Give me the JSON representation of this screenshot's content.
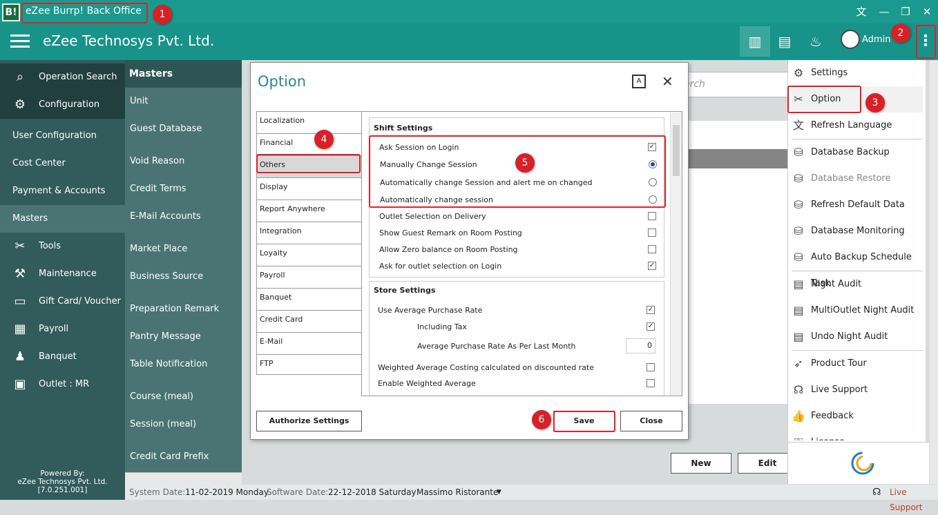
{
  "app": {
    "logo": "B!",
    "title": "eZee Burrp! Back Office",
    "company": "eZee Technosys Pvt. Ltd.",
    "admin": "Admin"
  },
  "nav": {
    "items": [
      {
        "label": "Operation Search",
        "icon": "search-icon"
      },
      {
        "label": "Configuration",
        "icon": "gear-icon"
      },
      {
        "label": "Tools",
        "icon": "tools-icon"
      },
      {
        "label": "Maintenance",
        "icon": "maintenance-icon"
      },
      {
        "label": "Gift Card/ Voucher",
        "icon": "gift-card-icon"
      },
      {
        "label": "Payroll",
        "icon": "payroll-icon"
      },
      {
        "label": "Banquet",
        "icon": "banquet-icon"
      },
      {
        "label": "Outlet : MR",
        "icon": "outlet-icon"
      }
    ],
    "sub": [
      "User Configuration",
      "Cost Center",
      "Payment & Accounts",
      "Masters"
    ],
    "powered": [
      "Powered By:",
      "eZee Technosys Pvt. Ltd.",
      "[7.0.251.001]"
    ]
  },
  "masters": {
    "title": "Masters",
    "items": [
      "Unit",
      "Guest Database",
      "Void Reason",
      "Credit Terms",
      "E-Mail Accounts",
      "Market Place",
      "Business Source",
      "Preparation Remark",
      "Pantry Message",
      "Table Notification",
      "Course (meal)",
      "Session (meal)",
      "Credit Card Prefix"
    ]
  },
  "content": {
    "search_placeholder": "arch"
  },
  "dialog": {
    "title": "Option",
    "tabs": [
      "Localization",
      "Financial",
      "Others",
      "Display",
      "Report Anywhere",
      "Integration",
      "Loyalty",
      "Payroll",
      "Banquet",
      "Credit Card",
      "E-Mail",
      "FTP"
    ],
    "shift": {
      "title": "Shift Settings",
      "options": [
        "Ask Session on Login",
        "Manually Change Session",
        "Automatically change Session and alert me on changed",
        "Automatically change session",
        "Outlet Selection on Delivery",
        "Show Guest Remark on Room Posting",
        "Allow Zero balance on Room Posting",
        "Ask for outlet selection on Login"
      ],
      "checked": [
        "Ask Session on Login",
        "Manually Change Session",
        "Ask for outlet selection on Login"
      ]
    },
    "store": {
      "title": "Store Settings",
      "options": [
        "Use Average Purchase Rate",
        "Including Tax",
        "Average Purchase Rate As Per Last Month",
        "Weighted Average Costing calculated on discounted rate",
        "Enable Weighted Average"
      ],
      "month_value": "0"
    },
    "authorize": "Authorize Settings",
    "save": "Save",
    "close": "Close"
  },
  "menu": [
    "Settings",
    "Option",
    "Refresh Language",
    "Database Backup",
    "Database Restore",
    "Refresh Default Data",
    "Database Monitoring",
    "Auto Backup Schedule Task",
    "Night Audit",
    "MultiOutlet Night Audit",
    "Undo Night Audit",
    "Product Tour",
    "Live Support",
    "Feedback",
    "License"
  ],
  "buttons": {
    "new": "New",
    "edit": "Edit"
  },
  "status": {
    "sys_label": "System Date:",
    "sys_value": "11-02-2019 Monday",
    "sw_label": "Software Date:",
    "sw_value": "22-12-2018 Saturday",
    "outlet": "Massimo Ristorante",
    "live": "Live Support"
  },
  "badges": [
    "1",
    "2",
    "3",
    "4",
    "5",
    "6"
  ],
  "colors": {
    "teal": "#17938a",
    "nav": "#325b5b",
    "annotation": "#e0202a"
  }
}
